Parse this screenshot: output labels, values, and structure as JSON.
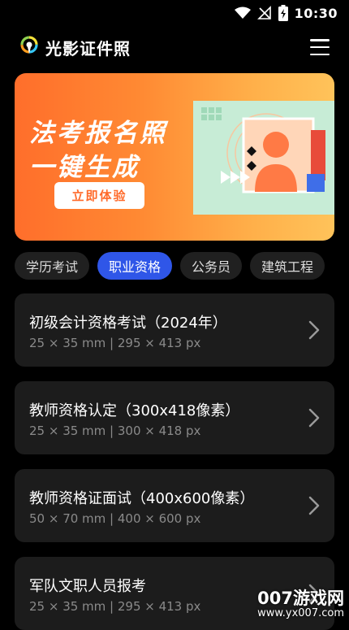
{
  "status_bar": {
    "time": "10:30"
  },
  "app": {
    "title": "光影证件照"
  },
  "banner": {
    "line1": "法考报名照",
    "line2": "一键生成",
    "cta": "立即体验"
  },
  "tabs": [
    {
      "label": "学历考试",
      "active": false
    },
    {
      "label": "职业资格",
      "active": true
    },
    {
      "label": "公务员",
      "active": false
    },
    {
      "label": "建筑工程",
      "active": false
    }
  ],
  "cards": [
    {
      "title": "初级会计资格考试（2024年）",
      "subtitle": "25 × 35 mm | 295 × 413 px"
    },
    {
      "title": "教师资格认定（300x418像素）",
      "subtitle": "25 × 35 mm | 300 × 418 px"
    },
    {
      "title": "教师资格证面试（400x600像素）",
      "subtitle": "50 × 70 mm | 400 × 600 px"
    },
    {
      "title": "军队文职人员报考",
      "subtitle": "25 × 35 mm | 295 × 413 px"
    }
  ],
  "watermark": {
    "line1": "007游戏网",
    "line2": "www.yx007.com"
  },
  "colors": {
    "accent": "#2f56e8",
    "banner": "#ff7a2e",
    "card": "#1c1c1c"
  }
}
